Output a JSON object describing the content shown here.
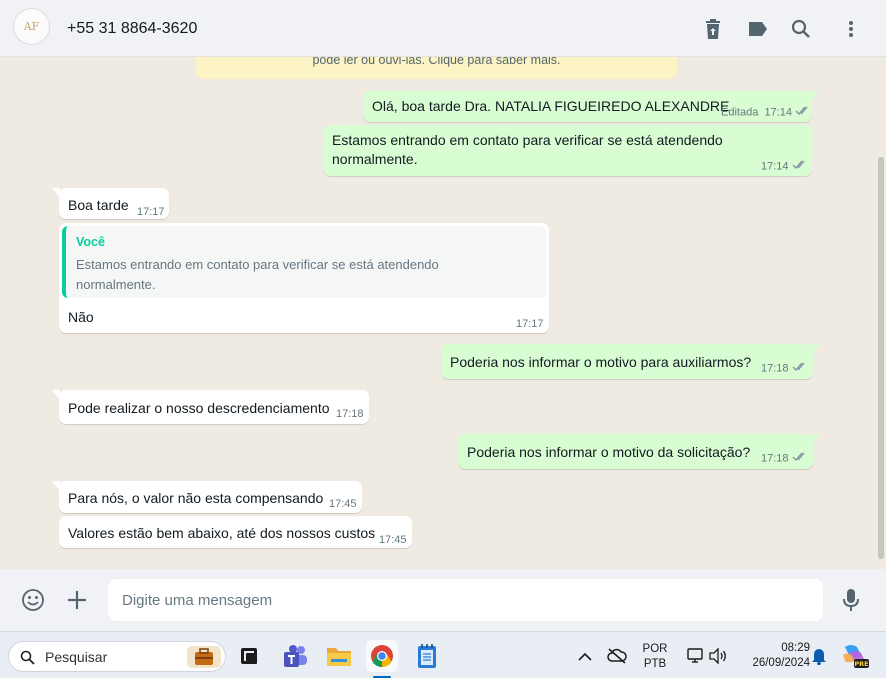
{
  "header": {
    "avatar_text": "AF",
    "contact": "+55 31 8864-3620",
    "icons": [
      "delete-icon",
      "label-icon",
      "search-icon",
      "menu-icon"
    ]
  },
  "chat": {
    "notice_text": "pode ler ou ouvi-las. Clique para saber mais.",
    "messages": [
      {
        "dir": "out",
        "text": "Olá, boa tarde Dra. NATALIA FIGUEIREDO ALEXANDRE",
        "edited": "Editada",
        "time": "17:14"
      },
      {
        "dir": "out",
        "text_line1": "Estamos entrando em contato para verificar se está atendendo",
        "text_line2": "normalmente.",
        "time": "17:14"
      },
      {
        "dir": "in",
        "text": "Boa tarde",
        "time": "17:17"
      },
      {
        "dir": "in",
        "quote_author": "Você",
        "quote_text": "Estamos entrando em contato para verificar se está atendendo normalmente.",
        "text": "Não",
        "time": "17:17"
      },
      {
        "dir": "out",
        "text": "Poderia nos informar o motivo para auxiliarmos?",
        "time": "17:18"
      },
      {
        "dir": "in",
        "text": "Pode realizar o nosso descredenciamento",
        "time": "17:18"
      },
      {
        "dir": "out",
        "text": "Poderia nos informar o motivo da solicitação?",
        "time": "17:18"
      },
      {
        "dir": "in",
        "text": "Para nós, o valor não esta compensando",
        "time": "17:45"
      },
      {
        "dir": "in",
        "text": "Valores estão bem abaixo, até dos nossos custos",
        "time": "17:45"
      }
    ]
  },
  "composer": {
    "placeholder": "Digite uma mensagem",
    "icons": [
      "emoji-icon",
      "plus-icon",
      "microphone-icon"
    ]
  },
  "taskbar": {
    "search_label": "Pesquisar",
    "lang_line1": "POR",
    "lang_line2": "PTB",
    "clock_time": "08:29",
    "clock_date": "26/09/2024",
    "copilot_badge": "PRE"
  },
  "colors": {
    "outgoing": "#d9fdd3",
    "incoming": "#ffffff",
    "accent": "#06cf9c",
    "chat_bg": "#efeae2"
  }
}
